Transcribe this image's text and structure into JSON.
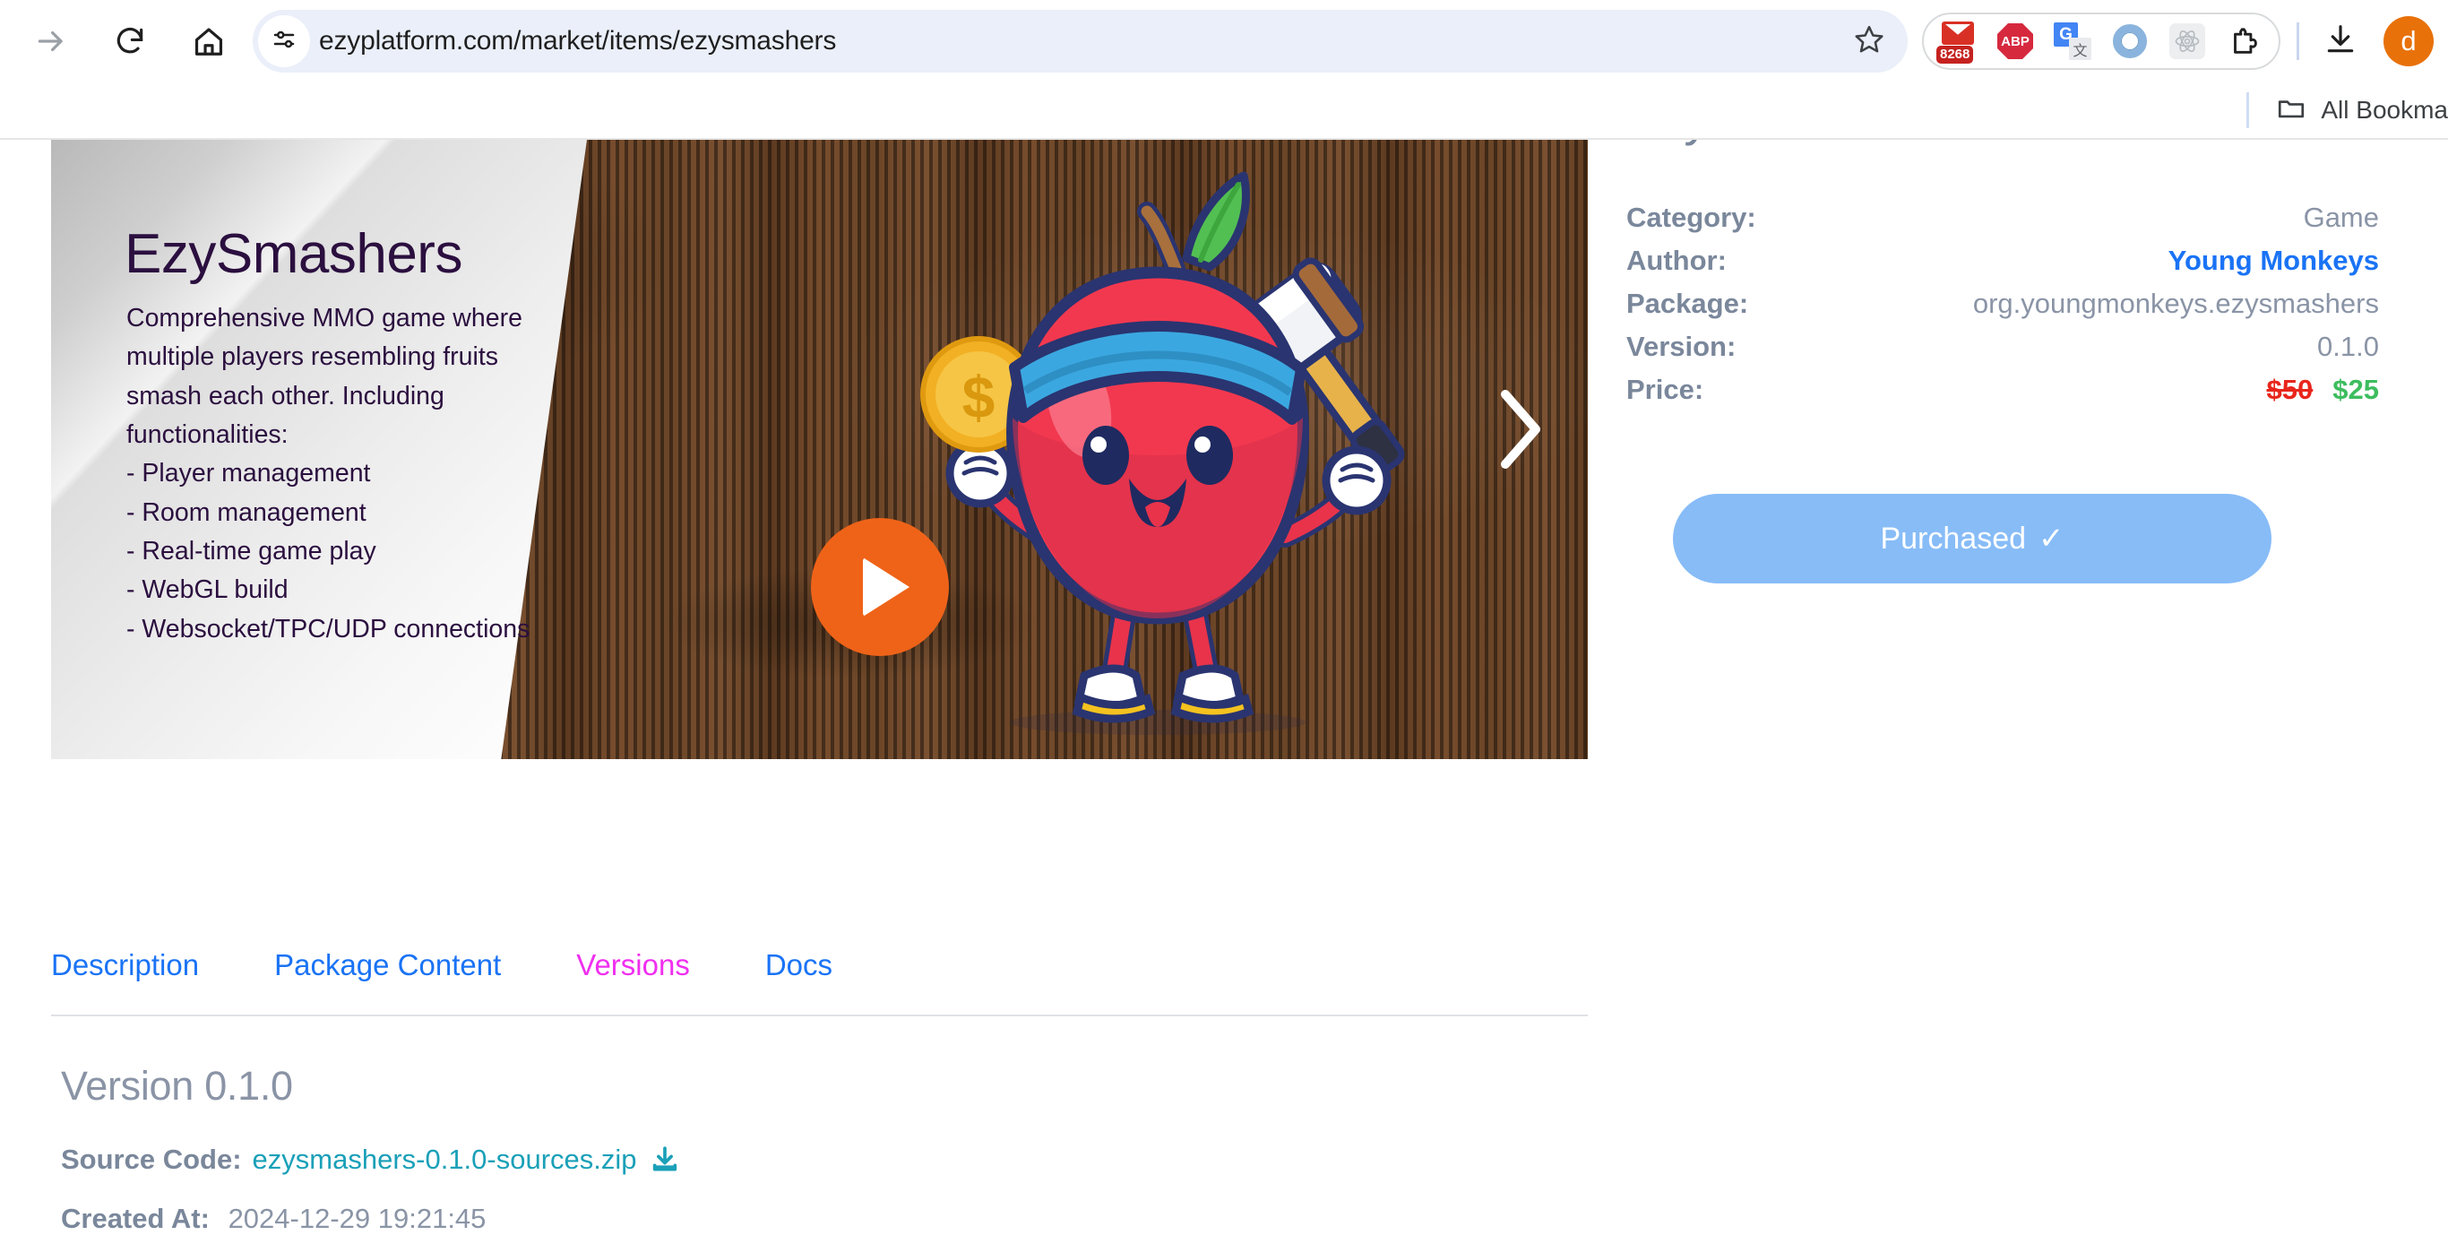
{
  "browser": {
    "nav": {
      "forward_icon": "arrow-forward-icon",
      "reload_icon": "reload-icon",
      "home_icon": "home-icon"
    },
    "omnibox": {
      "site_info_icon": "page-settings-icon",
      "url": "ezyplatform.com/market/items/ezysmashers",
      "bookmark_star_icon": "star-icon"
    },
    "extensions": [
      {
        "name": "gmail-extension-icon",
        "badge": "8268"
      },
      {
        "name": "adblock-plus-extension-icon",
        "label": "ABP"
      },
      {
        "name": "google-translate-extension-icon",
        "label": "G"
      },
      {
        "name": "blue-ring-extension-icon",
        "label": ""
      },
      {
        "name": "react-devtools-extension-icon",
        "label": ""
      },
      {
        "name": "extensions-puzzle-icon",
        "label": ""
      }
    ],
    "download_icon": "download-icon",
    "avatar_initial": "d",
    "bookmarks": {
      "folder_icon": "folder-icon",
      "all_bookmarks_label": "All Bookma"
    }
  },
  "banner": {
    "title": "EzySmashers",
    "description_lines": [
      "Comprehensive MMO game where",
      "multiple players resembling fruits",
      "smash each other. Including",
      "functionalities:",
      "- Player management",
      "- Room management",
      "- Real-time game play",
      "- WebGL build",
      "- Websocket/TPC/UDP connections"
    ],
    "play_icon": "play-icon",
    "next_icon": "chevron-right-icon",
    "mascot_icon": "apple-mascot-icon"
  },
  "detail": {
    "title": "EzySmashers",
    "rows": [
      {
        "label": "Category:",
        "value": "Game"
      },
      {
        "label": "Author:",
        "value": "Young Monkeys"
      },
      {
        "label": "Package:",
        "value": "org.youngmonkeys.ezysmashers"
      },
      {
        "label": "Version:",
        "value": "0.1.0"
      }
    ],
    "price_label": "Price:",
    "price_old": "$50",
    "price_new": "$25",
    "purchase_label": "Purchased",
    "purchase_check": "✓"
  },
  "tabs": [
    {
      "label": "Description",
      "active": false
    },
    {
      "label": "Package Content",
      "active": false
    },
    {
      "label": "Versions",
      "active": true
    },
    {
      "label": "Docs",
      "active": false
    }
  ],
  "version": {
    "heading": "Version 0.1.0",
    "source_label": "Source Code:",
    "source_file": "ezysmashers-0.1.0-sources.zip",
    "download_icon": "download-icon",
    "created_label": "Created At:",
    "created_value": "2024-12-29 19:21:45"
  },
  "colors": {
    "link_blue": "#1a73f5",
    "active_tab_magenta": "#f02ff0",
    "price_old_red": "#e8261c",
    "price_new_green": "#3dbd5e",
    "purchase_blue": "#87bcf7",
    "teal_link": "#1aa0b8",
    "accent_orange": "#ef6318"
  }
}
